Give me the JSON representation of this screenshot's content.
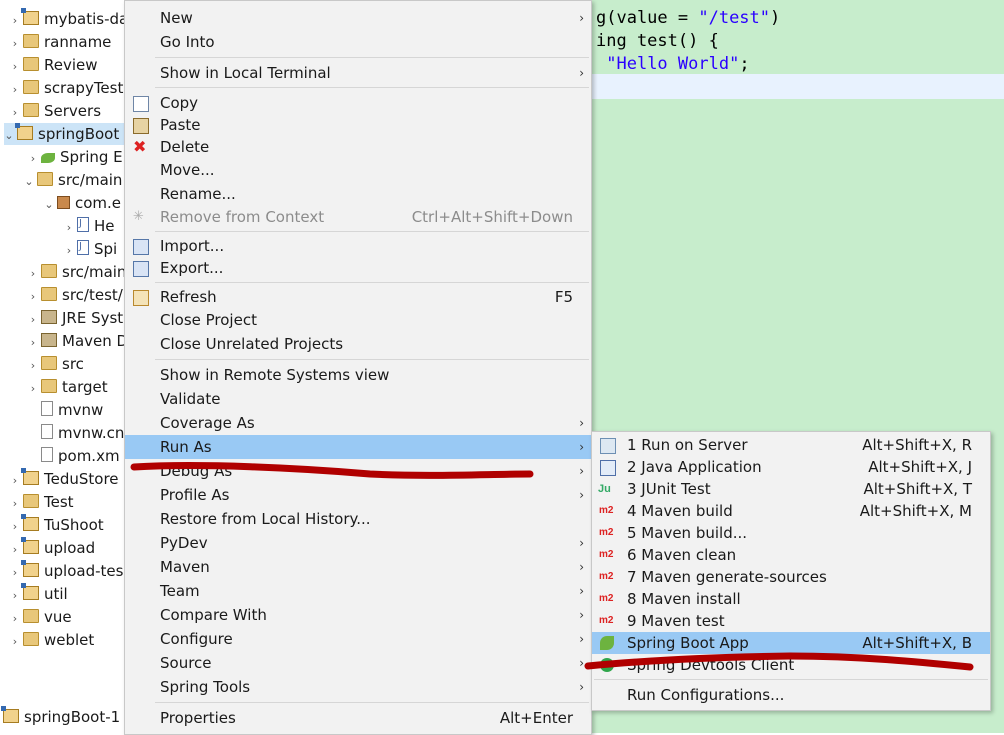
{
  "explorer": {
    "items": [
      {
        "label": "mybatis-da",
        "icon": "project-icon",
        "indent": 0
      },
      {
        "label": "ranname",
        "icon": "folder-icon",
        "indent": 0
      },
      {
        "label": "Review",
        "icon": "folder-icon",
        "indent": 0
      },
      {
        "label": "scrapyTest",
        "icon": "folder-icon",
        "indent": 0
      },
      {
        "label": "Servers",
        "icon": "folder-icon",
        "indent": 0
      },
      {
        "label": "springBoot",
        "icon": "project-icon",
        "indent": 0
      },
      {
        "label": "Spring E",
        "icon": "spring-icon",
        "indent": 1
      },
      {
        "label": "src/main",
        "icon": "folder-icon",
        "indent": 1
      },
      {
        "label": "com.e",
        "icon": "package-icon",
        "indent": 2
      },
      {
        "label": "He",
        "icon": "java-file-icon",
        "indent": 3
      },
      {
        "label": "Spi",
        "icon": "java-file-icon",
        "indent": 3
      },
      {
        "label": "src/main",
        "icon": "folder-icon",
        "indent": 1
      },
      {
        "label": "src/test/",
        "icon": "folder-icon",
        "indent": 1
      },
      {
        "label": "JRE Syst",
        "icon": "library-icon",
        "indent": 1
      },
      {
        "label": "Maven D",
        "icon": "library-icon",
        "indent": 1
      },
      {
        "label": "src",
        "icon": "folder-icon",
        "indent": 1
      },
      {
        "label": "target",
        "icon": "folder-icon",
        "indent": 1
      },
      {
        "label": "mvnw",
        "icon": "file-icon",
        "indent": 1
      },
      {
        "label": "mvnw.cn",
        "icon": "file-icon",
        "indent": 1
      },
      {
        "label": "pom.xm",
        "icon": "xml-file-icon",
        "indent": 1
      },
      {
        "label": "TeduStore",
        "icon": "project-icon",
        "indent": 0
      },
      {
        "label": "Test",
        "icon": "folder-icon",
        "indent": 0
      },
      {
        "label": "TuShoot",
        "icon": "project-icon",
        "indent": 0
      },
      {
        "label": "upload",
        "icon": "project-icon",
        "indent": 0
      },
      {
        "label": "upload-tes",
        "icon": "project-icon",
        "indent": 0
      },
      {
        "label": "util",
        "icon": "project-icon",
        "indent": 0
      },
      {
        "label": "vue",
        "icon": "folder-icon",
        "indent": 0
      },
      {
        "label": "weblet",
        "icon": "folder-icon",
        "indent": 0
      }
    ],
    "status_project": "springBoot-1"
  },
  "editor": {
    "line1_prefix": "g(value = ",
    "line1_string": "\"/test\"",
    "line1_suffix": ")",
    "line2": "ing test() {",
    "line3_string": "\"Hello World\"",
    "line3_suffix": ";"
  },
  "context_menu": {
    "items": [
      {
        "label": "New",
        "submenu": true
      },
      {
        "label": "Go Into"
      },
      {
        "label": "Show in Local Terminal",
        "submenu": true
      },
      {
        "label": "Copy",
        "icon": "copy-icon"
      },
      {
        "label": "Paste",
        "icon": "paste-icon"
      },
      {
        "label": "Delete",
        "icon": "delete-icon"
      },
      {
        "label": "Move..."
      },
      {
        "label": "Rename..."
      },
      {
        "label": "Remove from Context",
        "shortcut": "Ctrl+Alt+Shift+Down",
        "disabled": true
      },
      {
        "label": "Import...",
        "icon": "import-icon"
      },
      {
        "label": "Export...",
        "icon": "export-icon"
      },
      {
        "label": "Refresh",
        "shortcut": "F5",
        "icon": "refresh-icon"
      },
      {
        "label": "Close Project"
      },
      {
        "label": "Close Unrelated Projects"
      },
      {
        "label": "Show in Remote Systems view"
      },
      {
        "label": "Validate"
      },
      {
        "label": "Coverage As",
        "submenu": true
      },
      {
        "label": "Run As",
        "submenu": true,
        "highlighted": true
      },
      {
        "label": "Debug As",
        "submenu": true
      },
      {
        "label": "Profile As",
        "submenu": true
      },
      {
        "label": "Restore from Local History..."
      },
      {
        "label": "PyDev",
        "submenu": true
      },
      {
        "label": "Maven",
        "submenu": true
      },
      {
        "label": "Team",
        "submenu": true
      },
      {
        "label": "Compare With",
        "submenu": true
      },
      {
        "label": "Configure",
        "submenu": true
      },
      {
        "label": "Source",
        "submenu": true
      },
      {
        "label": "Spring Tools",
        "submenu": true
      },
      {
        "label": "Properties",
        "shortcut": "Alt+Enter"
      }
    ]
  },
  "run_as_submenu": {
    "items": [
      {
        "label": "1 Run on Server",
        "shortcut": "Alt+Shift+X, R",
        "icon": "server-icon"
      },
      {
        "label": "2 Java Application",
        "shortcut": "Alt+Shift+X, J",
        "icon": "java-app-icon"
      },
      {
        "label": "3 JUnit Test",
        "shortcut": "Alt+Shift+X, T",
        "icon": "junit-icon"
      },
      {
        "label": "4 Maven build",
        "shortcut": "Alt+Shift+X, M",
        "icon": "maven-m2-icon"
      },
      {
        "label": "5 Maven build...",
        "icon": "maven-m2-icon"
      },
      {
        "label": "6 Maven clean",
        "icon": "maven-m2-icon"
      },
      {
        "label": "7 Maven generate-sources",
        "icon": "maven-m2-icon"
      },
      {
        "label": "8 Maven install",
        "icon": "maven-m2-icon"
      },
      {
        "label": "9 Maven test",
        "icon": "maven-m2-icon"
      },
      {
        "label": "Spring Boot App",
        "shortcut": "Alt+Shift+X, B",
        "icon": "spring-boot-icon",
        "highlighted": true
      },
      {
        "label": "Spring Devtools Client",
        "icon": "devtools-icon"
      },
      {
        "label": "Run Configurations..."
      }
    ],
    "m2_badge": "m2",
    "junit_badge": "Ju"
  },
  "colors": {
    "menu_bg": "#f2f2f2",
    "highlight": "#99c9f4",
    "editor_bg": "#c7edcc",
    "annotation_red": "#b00000"
  }
}
